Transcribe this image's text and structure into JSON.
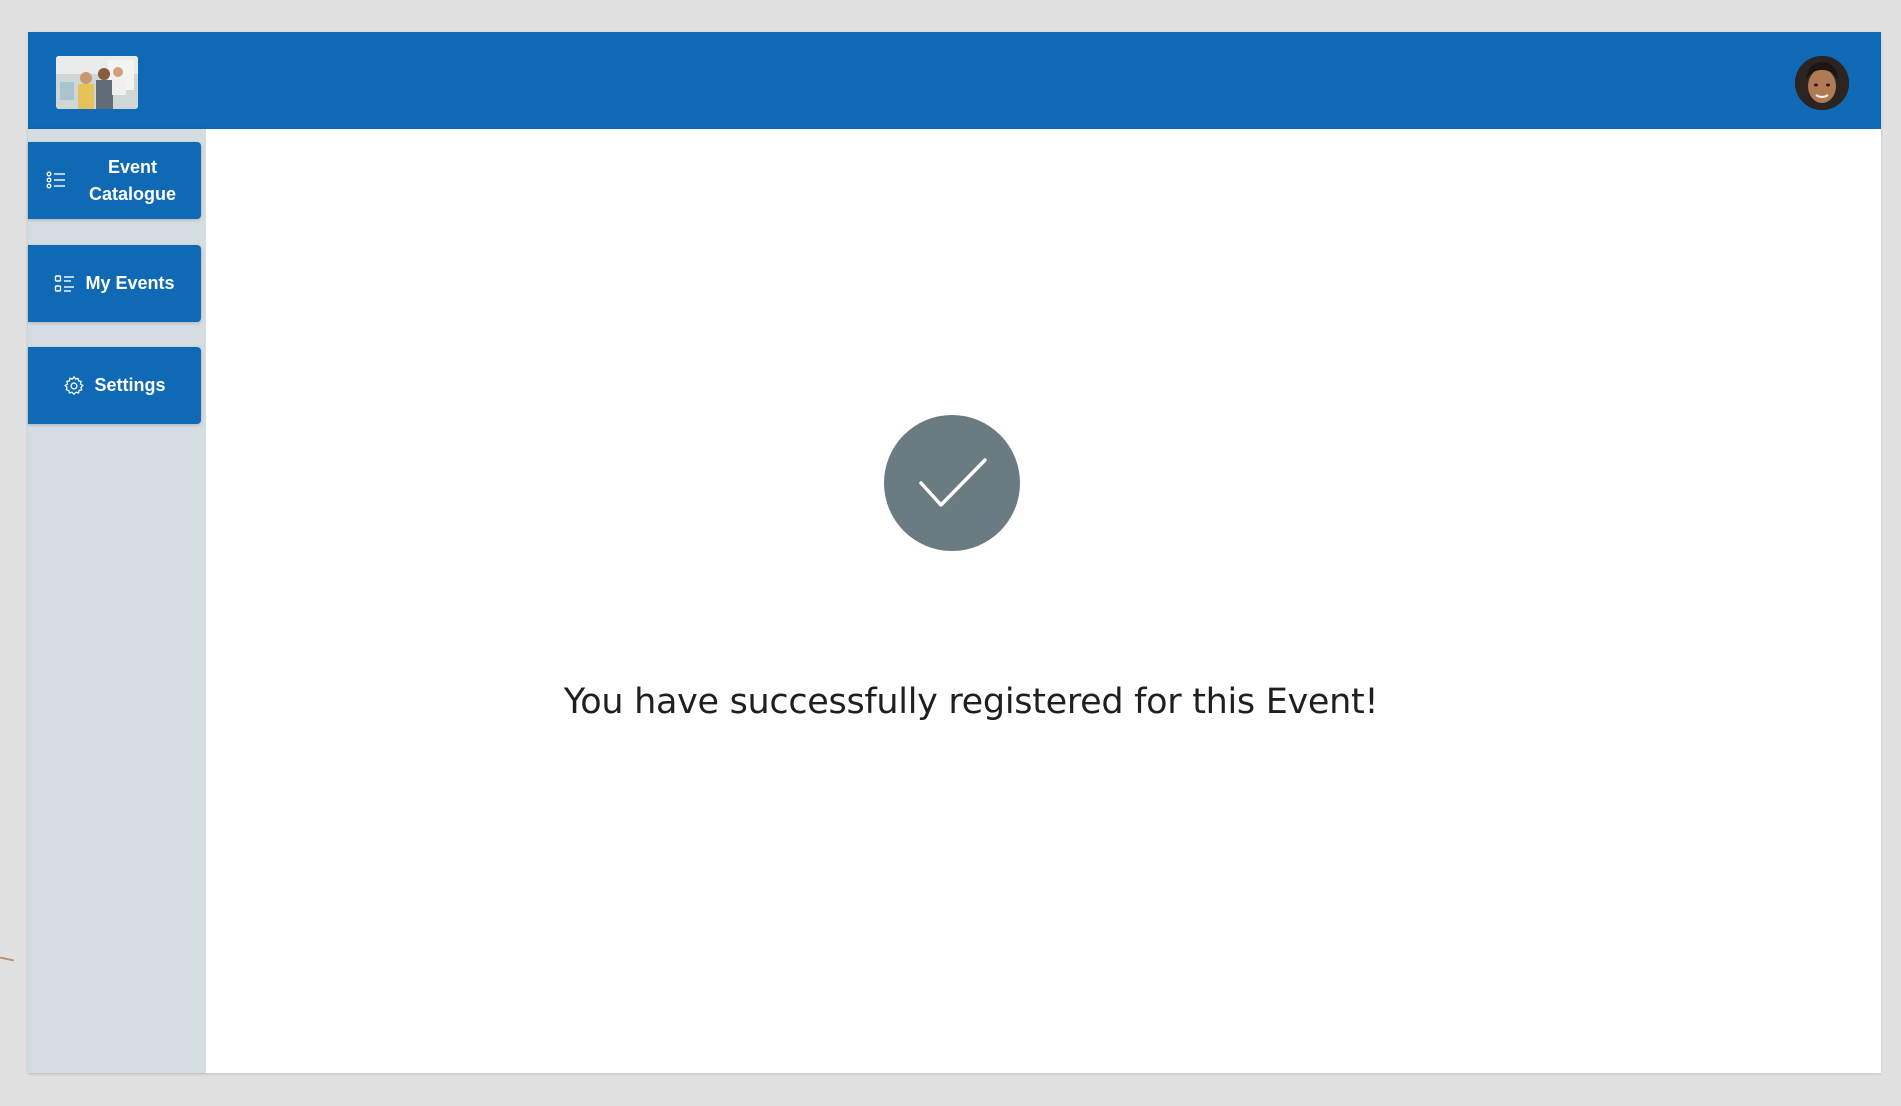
{
  "header": {
    "logo_icon": "team-photo-logo",
    "avatar_icon": "user-avatar",
    "color": "#0f69b4"
  },
  "sidebar": {
    "items": [
      {
        "label": "Event Catalogue",
        "icon": "list-icon"
      },
      {
        "label": "My Events",
        "icon": "checklist-icon"
      },
      {
        "label": "Settings",
        "icon": "gear-icon"
      }
    ]
  },
  "main": {
    "status_icon": "check-icon",
    "message": "You have successfully registered for this Event!"
  },
  "colors": {
    "accent": "#0f69b4",
    "sidebar_bg": "#d4dde2",
    "check_circle": "#6a7b82",
    "page_bg": "#e1e1e1"
  }
}
